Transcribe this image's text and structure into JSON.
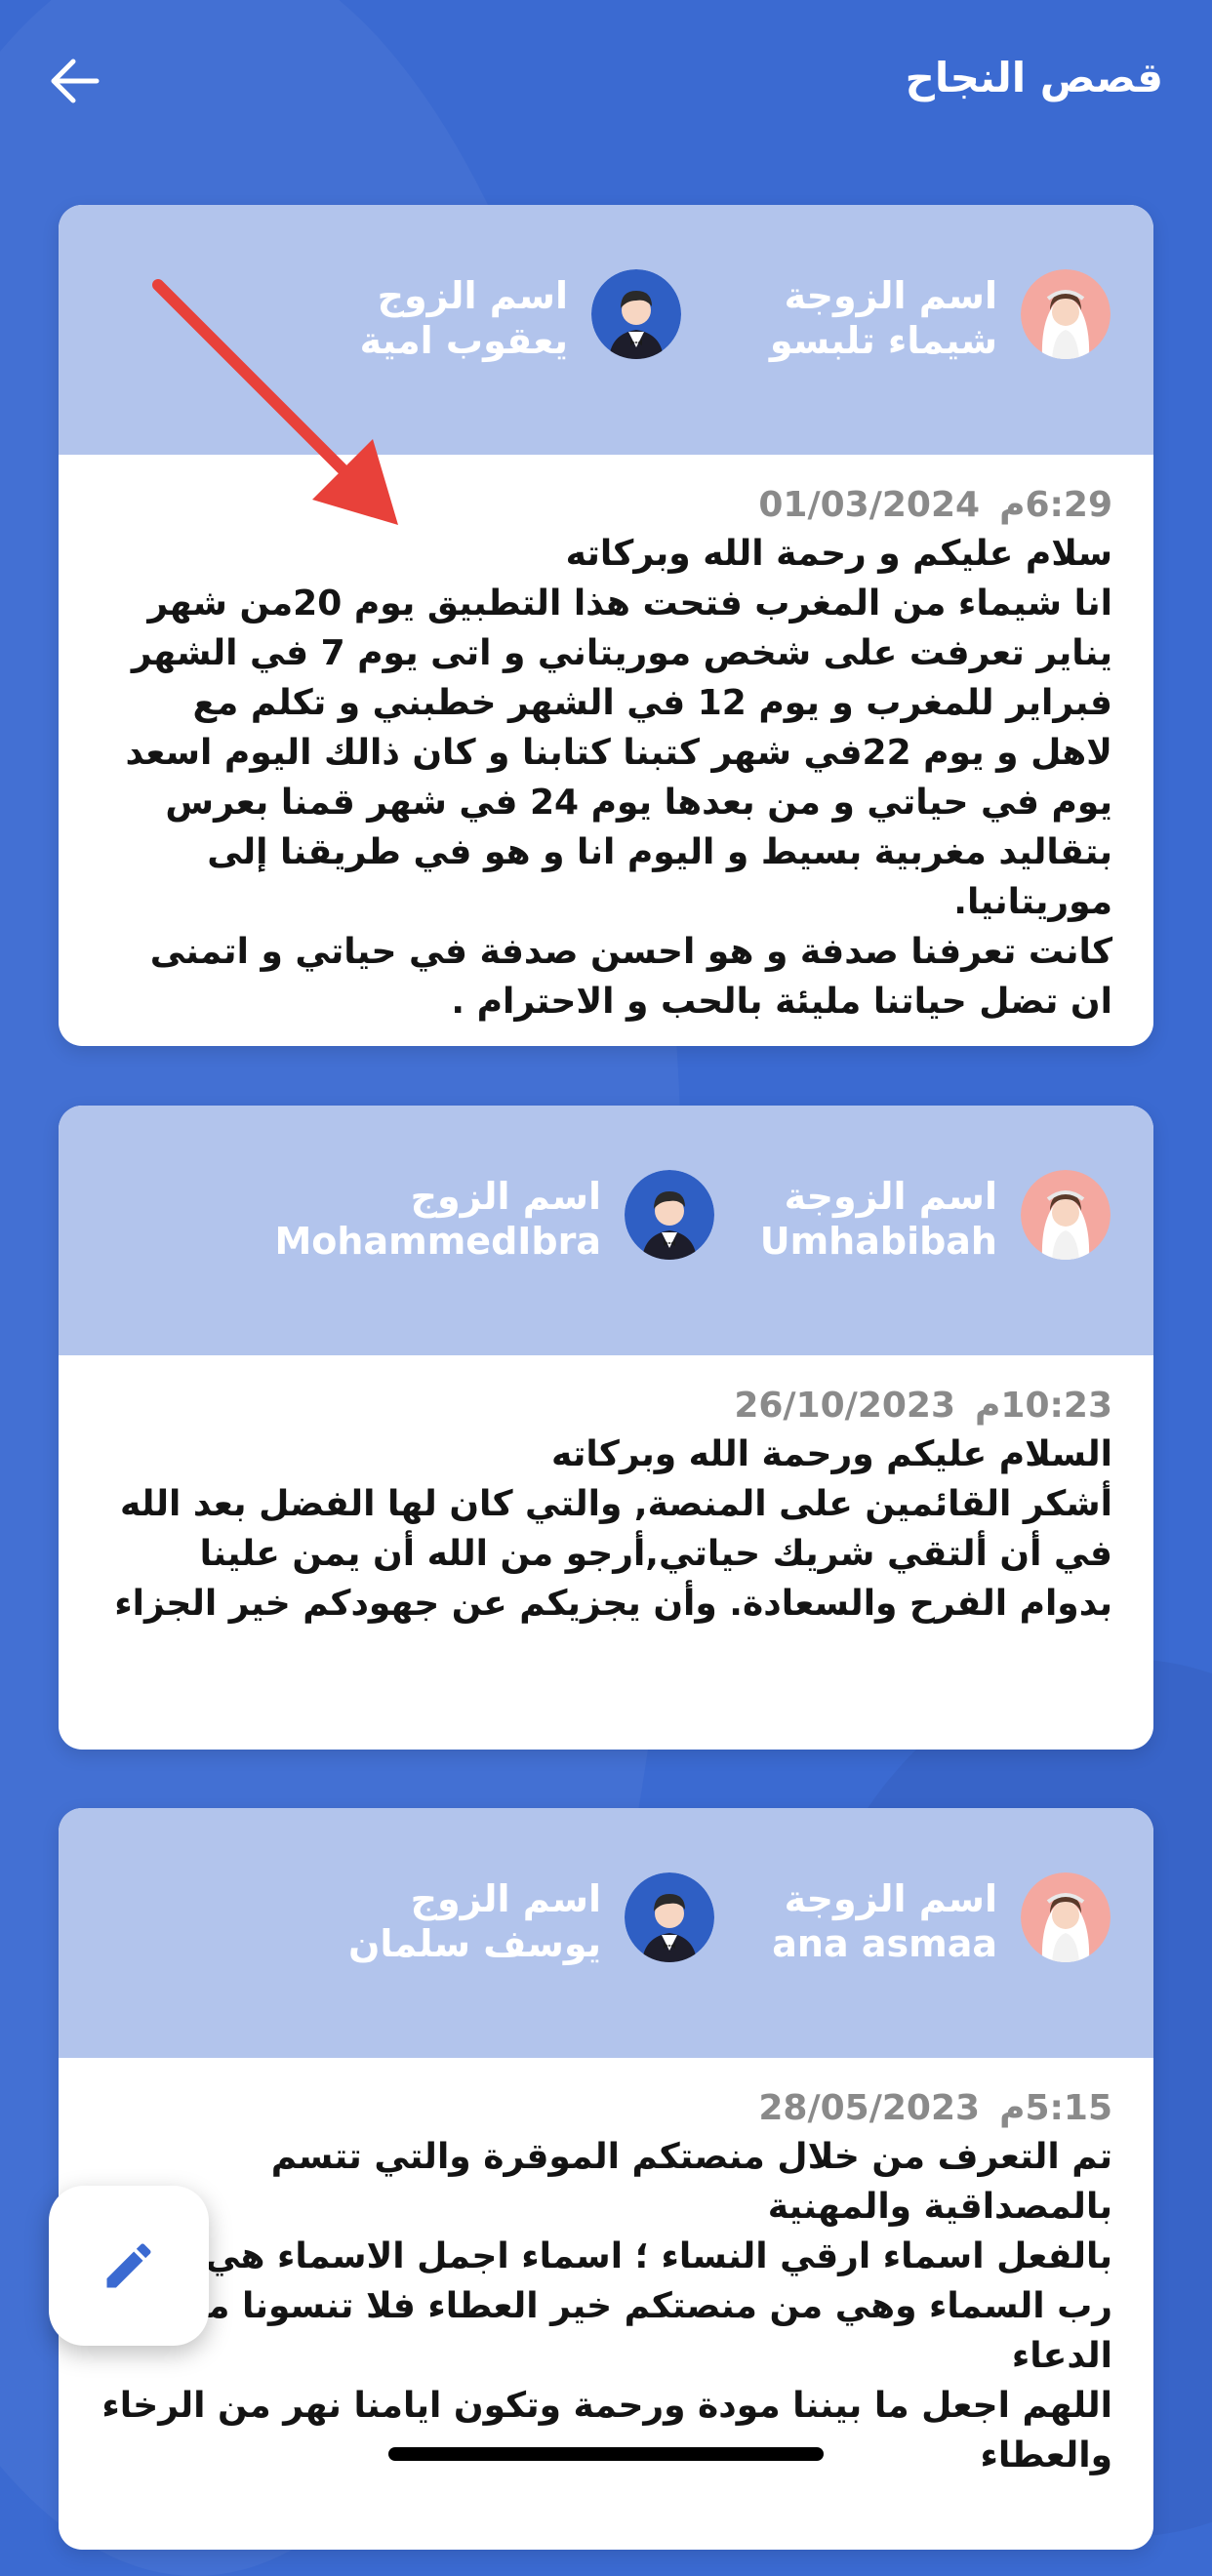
{
  "header": {
    "title": "قصص النجاح",
    "back_icon": "arrow-left-icon"
  },
  "labels": {
    "wife": "اسم الزوجة",
    "husband": "اسم الزوج"
  },
  "stories": [
    {
      "wife_name": "شيماء تلبسو",
      "husband_name": "يعقوب امية",
      "date": "01/03/2024",
      "time": "6:29م",
      "text": "سلام عليكم و رحمة الله وبركاته\nانا شيماء من المغرب فتحت هذا التطبيق يوم 20من شهر يناير تعرفت على شخص موريتاني و اتى يوم 7 في الشهر فبراير للمغرب و يوم 12 في الشهر خطبني و تكلم مع لاهل و يوم 22في شهر كتبنا كتابنا و كان ذالك اليوم اسعد يوم في حياتي و من بعدها يوم 24 في شهر قمنا بعرس بتقاليد مغربية بسيط و اليوم انا و هو في طريقنا إلى موريتانيا.\nكانت تعرفنا صدفة و هو احسن صدفة في حياتي و اتمنى ان تضل حياتنا مليئة بالحب و الاحترام ."
    },
    {
      "wife_name": "Umhabibah",
      "husband_name": "MohammedIbra",
      "date": "26/10/2023",
      "time": "10:23م",
      "text": "السلام عليكم ورحمة الله وبركاته\nأشكر القائمين على المنصة, والتي كان لها الفضل بعد الله في أن ألتقي شريك حياتي,أرجو من الله أن يمن علينا بدوام الفرح والسعادة. وأن يجزيكم عن جهودكم خير الجزاء"
    },
    {
      "wife_name": "ana asmaa",
      "husband_name": "يوسف سلمان",
      "date": "28/05/2023",
      "time": "5:15م",
      "text": "تم التعرف من خلال منصتكم الموقرة والتي تتسم بالمصداقية والمهنية\nبالفعل اسماء ارقي  النساء ؛ اسماء اجمل الاسماء هي هدية رب السماء وهي من منصتكم خير العطاء فلا تنسونا من الدعاء\nاللهم اجعل ما بيننا مودة ورحمة وتكون ايامنا نهر من الرخاء والعطاء"
    }
  ],
  "fab": {
    "icon": "pencil-icon"
  },
  "colors": {
    "background": "#3b6ad1",
    "card_header": "#b2c4ec",
    "annotation_arrow": "#e8413a"
  }
}
